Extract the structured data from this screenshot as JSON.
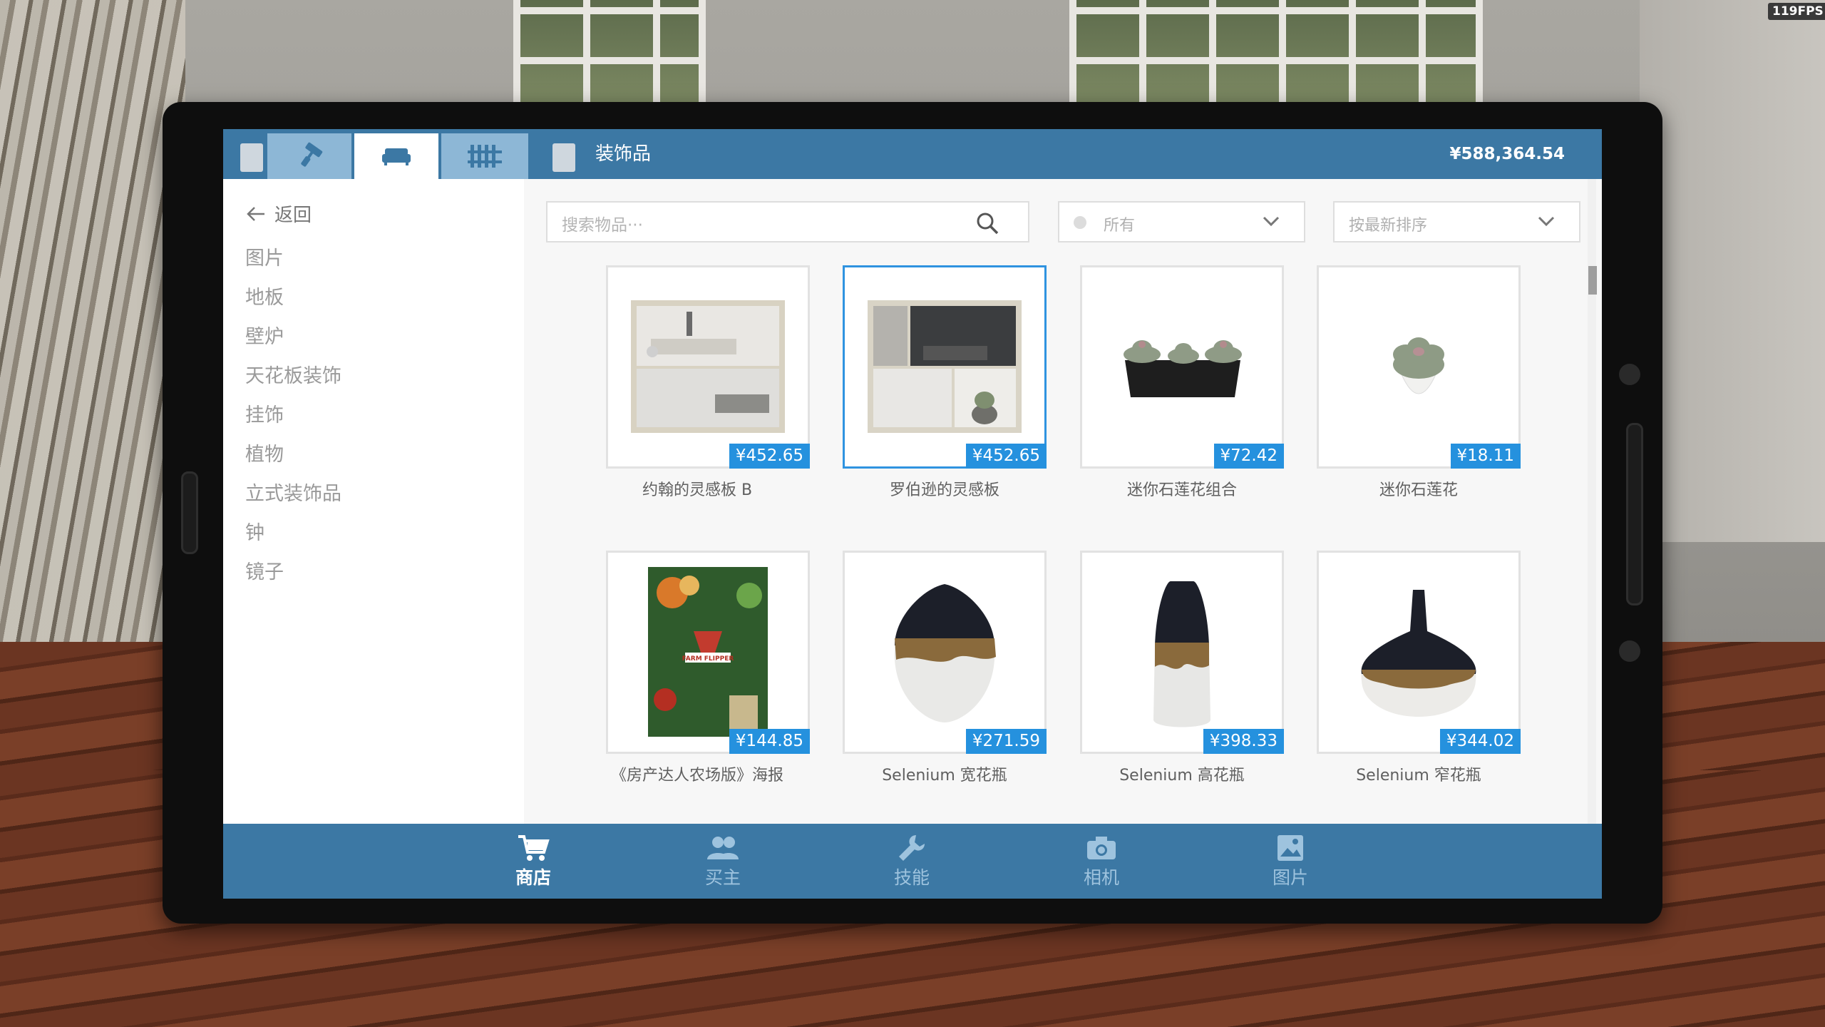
{
  "fps_label": "119FPS",
  "header": {
    "section_title": "装饰品",
    "balance": "¥588,364.54",
    "tabs": [
      {
        "icon": "paint-roller-icon"
      },
      {
        "icon": "sofa-icon",
        "active": true
      },
      {
        "icon": "fence-icon"
      }
    ]
  },
  "sidebar": {
    "back_label": "返回",
    "categories": [
      "图片",
      "地板",
      "壁炉",
      "天花板装饰",
      "挂饰",
      "植物",
      "立式装饰品",
      "钟",
      "镜子"
    ]
  },
  "filters": {
    "search_placeholder": "搜索物品···",
    "category_value": "所有",
    "sort_value": "按最新排序"
  },
  "items": [
    {
      "name": "约翰的灵感板 B",
      "price": "¥452.65"
    },
    {
      "name": "罗伯逊的灵感板",
      "price": "¥452.65",
      "selected": true
    },
    {
      "name": "迷你石莲花组合",
      "price": "¥72.42"
    },
    {
      "name": "迷你石莲花",
      "price": "¥18.11"
    },
    {
      "name": "《房产达人农场版》海报",
      "price": "¥144.85"
    },
    {
      "name": "Selenium 宽花瓶",
      "price": "¥271.59"
    },
    {
      "name": "Selenium 高花瓶",
      "price": "¥398.33"
    },
    {
      "name": "Selenium 窄花瓶",
      "price": "¥344.02"
    }
  ],
  "poster_text": "FARM FLIPPER",
  "bottom_nav": [
    {
      "label": "商店",
      "icon": "cart-icon",
      "active": true
    },
    {
      "label": "买主",
      "icon": "buyers-icon"
    },
    {
      "label": "技能",
      "icon": "wrench-icon"
    },
    {
      "label": "相机",
      "icon": "camera-icon"
    },
    {
      "label": "图片",
      "icon": "picture-icon"
    }
  ],
  "colors": {
    "accent": "#3c78a4",
    "tab_inactive": "#8db7d6",
    "price_tag": "#2591de",
    "selected_border": "#2f93e0"
  }
}
